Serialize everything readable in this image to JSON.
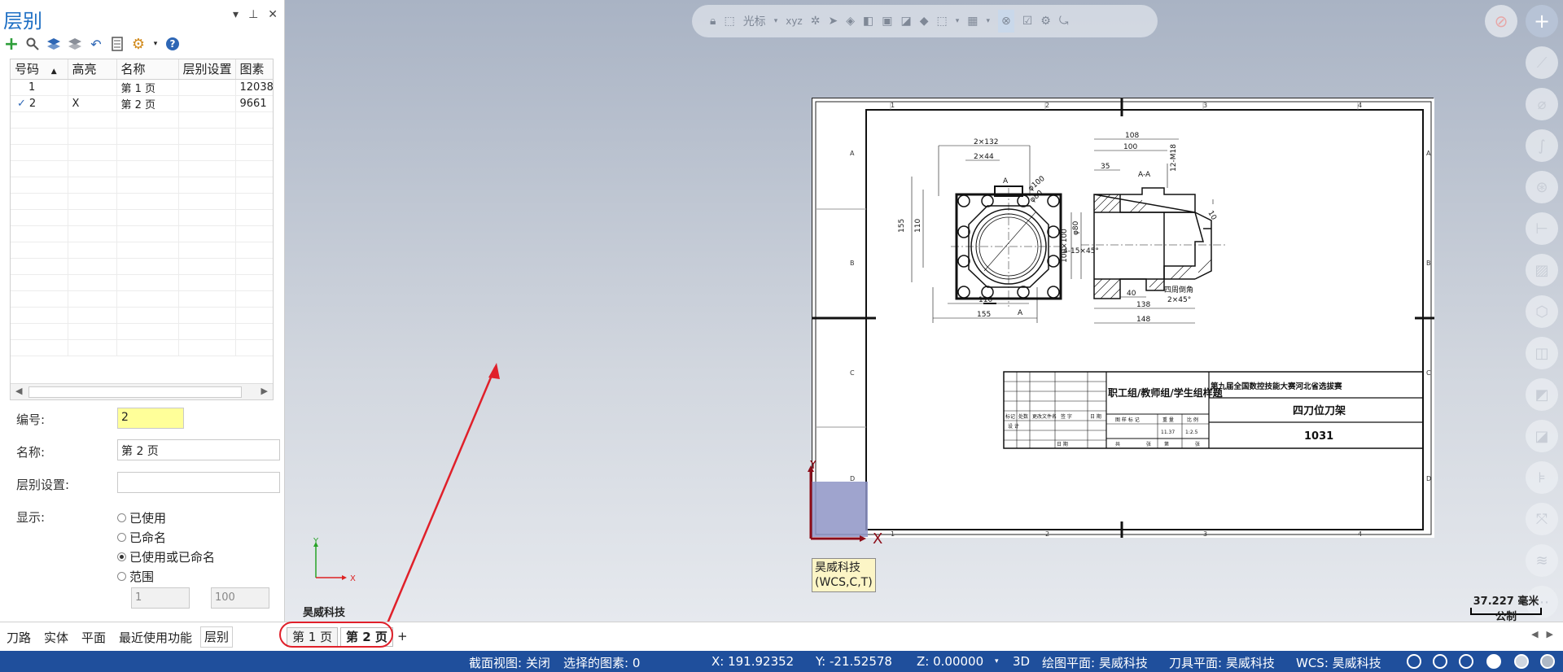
{
  "panel": {
    "title": "层别",
    "controls": [
      "▾",
      "⊥",
      "✕"
    ],
    "columns": [
      "号码",
      "高亮",
      "名称",
      "层别设置",
      "图素"
    ],
    "rows": [
      {
        "check": "",
        "number": "1",
        "highlight": "",
        "name": "第 1 页",
        "setting": "",
        "count": "12038"
      },
      {
        "check": "✓",
        "number": "2",
        "highlight": "X",
        "name": "第 2 页",
        "setting": "",
        "count": "9661"
      }
    ],
    "props": {
      "number_label": "编号:",
      "number_value": "2",
      "name_label": "名称:",
      "name_value": "第 2 页",
      "setting_label": "层别设置:",
      "setting_value": "",
      "display_label": "显示:",
      "options": [
        "已使用",
        "已命名",
        "已使用或已命名",
        "范围"
      ],
      "selected_option": "已使用或已命名",
      "range_from": "1",
      "range_to": "100"
    }
  },
  "toolbar_top": {
    "cursor_label": "光标"
  },
  "viewport": {
    "wcs_line1": "昊威科技",
    "wcs_line2": "(WCS,C,T)",
    "axis_x": "X",
    "axis_y": "Y",
    "company": "昊威科技",
    "scale_value": "37.227 毫米",
    "scale_unit": "公制"
  },
  "drawing": {
    "title_block_line": "职工组/教师组/学生组样题",
    "competition": "第九届全国数控技能大赛河北省选拔赛",
    "part_name": "四刀位刀架",
    "drawing_number": "1031",
    "dim_2x132": "2×132",
    "dim_2x44": "2×44",
    "dim_155v": "155",
    "dim_110v": "110",
    "dim_110h": "110",
    "dim_155h": "155",
    "dim_phi100": "φ100",
    "dim_phi80": "φ80",
    "dim_4x15": "4-15×45°",
    "dim_108": "108",
    "dim_100": "100",
    "dim_35": "35",
    "dim_100x100": "100×100",
    "dim_phi80b": "φ80",
    "dim_40": "40",
    "dim_138": "138",
    "dim_148": "148",
    "dim_chamfer": "四周倒角",
    "dim_2x45": "2×45°",
    "dim_12m18": "12-M18",
    "dim_10": "10",
    "dim_aa": "A-A",
    "dim_a": "A",
    "tb_labels": [
      "标记",
      "处数",
      "更改文件名",
      "签 字",
      "日 期",
      "设 计",
      "日 期",
      "图 样 标 记",
      "重 量",
      "比 例",
      "共",
      "张",
      "第",
      "张"
    ],
    "tb_weight": "11.37",
    "tb_scale": "1:2.5",
    "zone_numbers": [
      "1",
      "2",
      "3",
      "4"
    ],
    "zone_letters": [
      "A",
      "B",
      "C",
      "D"
    ]
  },
  "tabs": {
    "left": [
      "刀路",
      "实体",
      "平面",
      "最近使用功能",
      "层别"
    ],
    "active_left": "层别",
    "pages": [
      "第 1 页",
      "第 2 页"
    ],
    "active_page": "第 2 页",
    "add": "+"
  },
  "status": {
    "section_view": "截面视图: 关闭",
    "selected": "选择的图素: 0",
    "x": "X:   191.92352",
    "y": "Y:   -21.52578",
    "z": "Z:   0.00000",
    "mode": "3D",
    "plane": "绘图平面: 昊威科技",
    "tool_plane": "刀具平面: 昊威科技",
    "wcs": "WCS: 昊威科技"
  },
  "colors": {
    "accent": "#1e6fc4",
    "status_bar": "#1f4f9c",
    "highlight_field": "#ffff99",
    "annotation_red": "#e0202a"
  }
}
